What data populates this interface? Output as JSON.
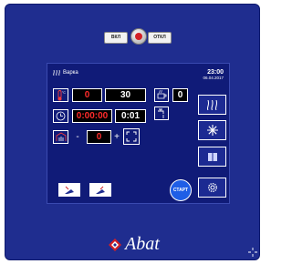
{
  "device": {
    "knob": {
      "left_label": "ВКЛ",
      "right_label": "ОТКЛ"
    },
    "screen": {
      "mode_title": "Варка",
      "clock": {
        "time": "23:00",
        "date": "06.04.2017"
      },
      "temperature": {
        "set_value": "0",
        "actual_value": "30"
      },
      "timer": {
        "countdown": "0:00:00",
        "set_time": "0:01"
      },
      "humidity": {
        "minus_label": "-",
        "value": "0",
        "plus_label": "+"
      },
      "portion": {
        "value": "0"
      },
      "start_label": "СТАРТ",
      "side_buttons": [
        {
          "name": "steam-mode",
          "icon": "steam-icon"
        },
        {
          "name": "cooling-mode",
          "icon": "snowflake-icon"
        },
        {
          "name": "recipes-book",
          "icon": "book-icon"
        },
        {
          "name": "settings",
          "icon": "gear-icon"
        }
      ],
      "colors": {
        "accent_red": "#ff2b2b",
        "start_blue": "#1f5ee6",
        "panel_blue": "#1f2d8f"
      }
    },
    "brand": {
      "name": "Abat"
    }
  }
}
